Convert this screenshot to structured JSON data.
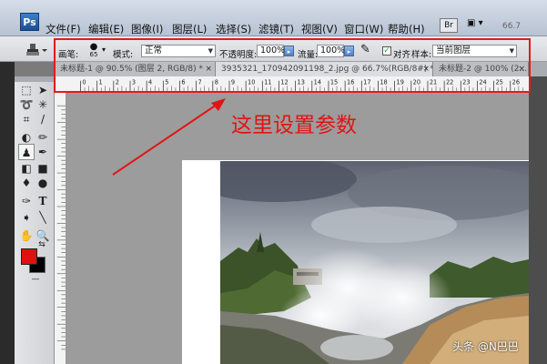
{
  "app": {
    "logo": "Ps"
  },
  "menu": [
    {
      "label": "文件(F)"
    },
    {
      "label": "编辑(E)"
    },
    {
      "label": "图像(I)"
    },
    {
      "label": "图层(L)"
    },
    {
      "label": "选择(S)"
    },
    {
      "label": "滤镜(T)"
    },
    {
      "label": "视图(V)"
    },
    {
      "label": "窗口(W)"
    },
    {
      "label": "帮助(H)"
    }
  ],
  "appbar": {
    "bridge_label": "Br",
    "screen_mode": "▣ ▾",
    "zoom": "66.7"
  },
  "options": {
    "brush_label": "画笔:",
    "brush_size": "65",
    "mode_label": "模式:",
    "mode_value": "正常",
    "opacity_label": "不透明度:",
    "opacity_value": "100%",
    "flow_label": "流量:",
    "flow_value": "100%",
    "aligned_label": "对齐",
    "sample_label": "样本:",
    "sample_value": "当前图层"
  },
  "tabs": [
    {
      "label": "未标题-1 @ 90.5% (图层 2, RGB/8) *",
      "close": "×"
    },
    {
      "label": "3935321_170942091198_2.jpg @ 66.7%(RGB/8#) *",
      "close": "×"
    },
    {
      "label": "未标题-2 @ 100% (2...",
      "close": "×"
    }
  ],
  "ruler": {
    "labels": [
      "0",
      "1",
      "2",
      "3",
      "4",
      "5",
      "6",
      "7",
      "8",
      "9",
      "10",
      "11",
      "12",
      "13",
      "14",
      "15",
      "16",
      "17",
      "18",
      "19",
      "20",
      "21",
      "22",
      "23",
      "24",
      "25",
      "26"
    ]
  },
  "annotation": {
    "text": "这里设置参数",
    "color": "#e01414"
  },
  "watermark": "头条 @N巴巴",
  "colors": {
    "foreground": "#e01010",
    "background": "#000000",
    "highlight": "#e21b1b"
  },
  "tools": [
    {
      "icon": "marquee-icon"
    },
    {
      "icon": "move-icon"
    },
    {
      "icon": "lasso-icon"
    },
    {
      "icon": "magic-wand-icon"
    },
    {
      "icon": "crop-icon"
    },
    {
      "icon": "eyedropper-icon"
    },
    {
      "icon": "healing-brush-icon"
    },
    {
      "icon": "brush-icon"
    },
    {
      "icon": "clone-stamp-icon"
    },
    {
      "icon": "history-brush-icon"
    },
    {
      "icon": "eraser-icon"
    },
    {
      "icon": "gradient-icon"
    },
    {
      "icon": "blur-icon"
    },
    {
      "icon": "dodge-icon"
    },
    {
      "icon": "pen-icon"
    },
    {
      "icon": "type-icon"
    },
    {
      "icon": "path-selection-icon"
    },
    {
      "icon": "line-icon"
    },
    {
      "icon": "hand-icon"
    },
    {
      "icon": "zoom-icon"
    }
  ]
}
